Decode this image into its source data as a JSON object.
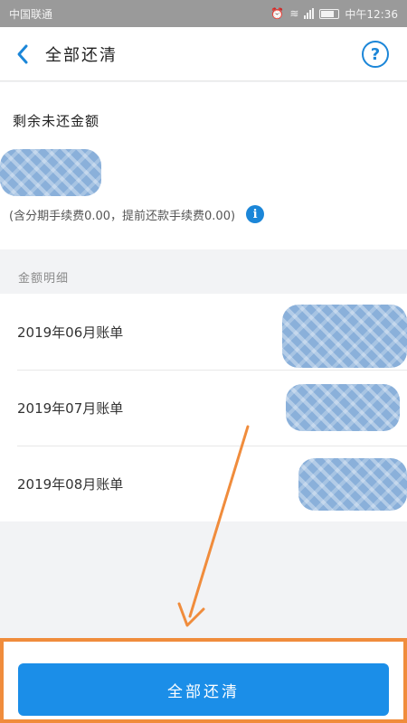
{
  "status_bar": {
    "carrier": "中国联通",
    "time": "中午12:36"
  },
  "nav": {
    "title": "全部还清",
    "help_icon": "?"
  },
  "summary": {
    "label": "剩余未还金额",
    "fee_note": "(含分期手续费0.00，提前还款手续费0.00)",
    "info_icon": "i"
  },
  "details": {
    "section_title": "金额明细",
    "bills": [
      {
        "label": "2019年06月账单"
      },
      {
        "label": "2019年07月账单"
      },
      {
        "label": "2019年08月账单"
      }
    ]
  },
  "footer": {
    "button_label": "全部还清"
  },
  "colors": {
    "accent": "#1b8ee8",
    "annotation": "#f08c3c",
    "redaction": "#8ab0da"
  }
}
